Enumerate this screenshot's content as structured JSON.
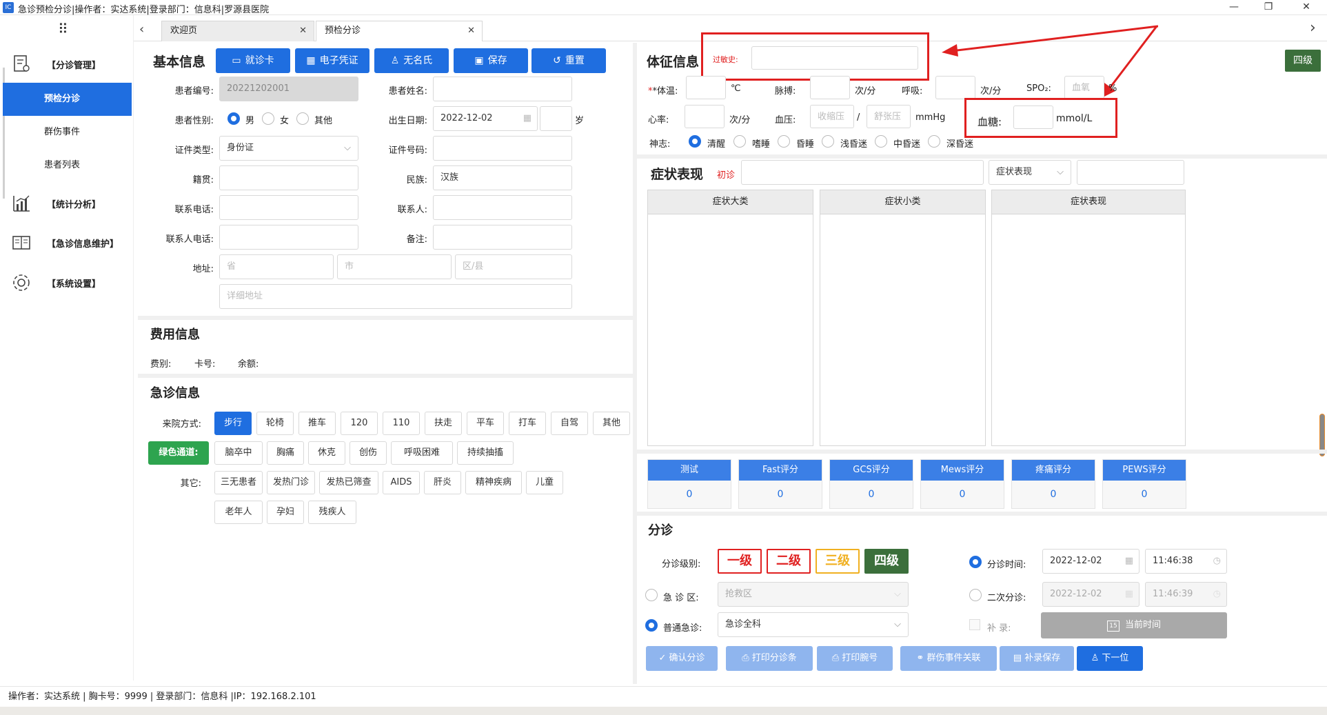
{
  "titlebar": {
    "icon_text": "IC",
    "title": "急诊预检分诊|操作者：实达系统|登录部门：信息科|罗源县医院"
  },
  "sidebar": {
    "groups": [
      {
        "label": "【分诊管理】",
        "icon": "triage-doc-icon"
      },
      {
        "label": "【统计分析】",
        "icon": "chart-icon"
      },
      {
        "label": "【急诊信息维护】",
        "icon": "book-icon"
      },
      {
        "label": "【系统设置】",
        "icon": "gear-icon"
      }
    ],
    "subitems": [
      "预检分诊",
      "群伤事件",
      "患者列表"
    ]
  },
  "tabs": [
    {
      "label": "欢迎页"
    },
    {
      "label": "预检分诊"
    }
  ],
  "basic": {
    "title": "基本信息",
    "buttons": [
      "就诊卡",
      "电子凭证",
      "无名氏",
      "保存",
      "重置"
    ],
    "patient_no_label": "患者编号:",
    "patient_no": "20221202001",
    "patient_name_label": "患者姓名:",
    "gender_label": "患者性别:",
    "gender_options": [
      "男",
      "女",
      "其他"
    ],
    "dob_label": "出生日期:",
    "dob": "2022-12-02",
    "age_unit": "岁",
    "idtype_label": "证件类型:",
    "idtype": "身份证",
    "idno_label": "证件号码:",
    "native_label": "籍贯:",
    "ethnic_label": "民族:",
    "ethnic": "汉族",
    "phone_label": "联系电话:",
    "contact_label": "联系人:",
    "contact_phone_label": "联系人电话:",
    "remark_label": "备注:",
    "address_label": "地址:",
    "province_ph": "省",
    "city_ph": "市",
    "district_ph": "区/县",
    "detail_ph": "详细地址"
  },
  "fee": {
    "title": "费用信息",
    "type_label": "费别:",
    "card_label": "卡号:",
    "balance_label": "余额:"
  },
  "emerg": {
    "title": "急诊信息",
    "arrival_label": "来院方式:",
    "arrival": [
      "步行",
      "轮椅",
      "推车",
      "120",
      "110",
      "扶走",
      "平车",
      "打车",
      "自驾",
      "其他"
    ],
    "green_label": "绿色通道:",
    "green": [
      "脑卒中",
      "胸痛",
      "休克",
      "创伤",
      "呼吸困难",
      "持续抽搐"
    ],
    "other_label": "其它:",
    "other": [
      "三无患者",
      "发热门诊",
      "发热已筛查",
      "AIDS",
      "肝炎",
      "精神疾病",
      "儿童",
      "老年人",
      "孕妇",
      "残疾人"
    ]
  },
  "vitals": {
    "title": "体征信息",
    "allergy_label": "过敏史:",
    "level_badge": "四级",
    "temp_label": "*体温:",
    "temp_unit": "℃",
    "pulse_label": "脉搏:",
    "pulse_unit": "次/分",
    "resp_label": "呼吸:",
    "resp_unit": "次/分",
    "spo2_label": "SPO₂:",
    "spo2_ph": "血氧",
    "spo2_unit": "%",
    "hr_label": "心率:",
    "hr_unit": "次/分",
    "bp_label": "血压:",
    "sys_ph": "收缩压",
    "dia_ph": "舒张压",
    "bp_sep": "/",
    "bp_unit": "mmHg",
    "glucose_label": "血糖:",
    "glucose_unit": "mmol/L",
    "consc_label": "神志:",
    "consc": [
      "清醒",
      "嗜睡",
      "昏睡",
      "浅昏迷",
      "中昏迷",
      "深昏迷"
    ]
  },
  "symptoms": {
    "title": "症状表现",
    "first_visit": "初诊",
    "select": "症状表现",
    "cols": [
      "症状大类",
      "症状小类",
      "症状表现"
    ]
  },
  "scores": [
    {
      "name": "测试",
      "value": "0"
    },
    {
      "name": "Fast评分",
      "value": "0"
    },
    {
      "name": "GCS评分",
      "value": "0"
    },
    {
      "name": "Mews评分",
      "value": "0"
    },
    {
      "name": "疼痛评分",
      "value": "0"
    },
    {
      "name": "PEWS评分",
      "value": "0"
    }
  ],
  "triage": {
    "title": "分诊",
    "level_label": "分诊级别:",
    "levels": [
      "一级",
      "二级",
      "三级",
      "四级"
    ],
    "time_label": "分诊时间:",
    "date": "2022-12-02",
    "time": "11:46:38",
    "er_label": "急 诊 区:",
    "er_value": "抢救区",
    "second_label": "二次分诊:",
    "date2": "2022-12-02",
    "time2": "11:46:39",
    "general_label": "普通急诊:",
    "general_value": "急诊全科",
    "supp_label": "补    录:",
    "now_btn": "当前时间",
    "cal_day": "15",
    "actions": [
      "确认分诊",
      "打印分诊条",
      "打印腕号",
      "群伤事件关联",
      "补录保存",
      "下一位"
    ]
  },
  "status": "操作者：实达系统 | 胸卡号：9999 | 登录部门：信息科 |IP：192.168.2.101",
  "colors": {
    "primary": "#1f6ee0",
    "highlight": "#e02020",
    "green": "#2ea44f"
  }
}
